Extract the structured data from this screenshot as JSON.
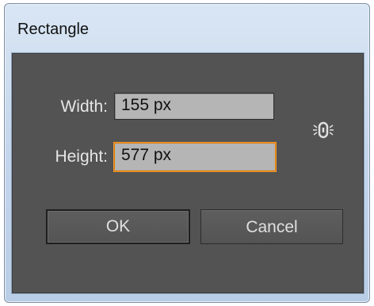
{
  "dialog": {
    "title": "Rectangle"
  },
  "fields": {
    "width": {
      "label": "Width:",
      "value": "155 px"
    },
    "height": {
      "label": "Height:",
      "value": "577 px"
    }
  },
  "constrain_icon": "chain-link-icon",
  "buttons": {
    "ok_label": "OK",
    "cancel_label": "Cancel"
  },
  "colors": {
    "panel_bg": "#535353",
    "focus_border": "#e07b00",
    "field_bg": "#b5b5b5",
    "title_bar": "#c4d6ec"
  }
}
